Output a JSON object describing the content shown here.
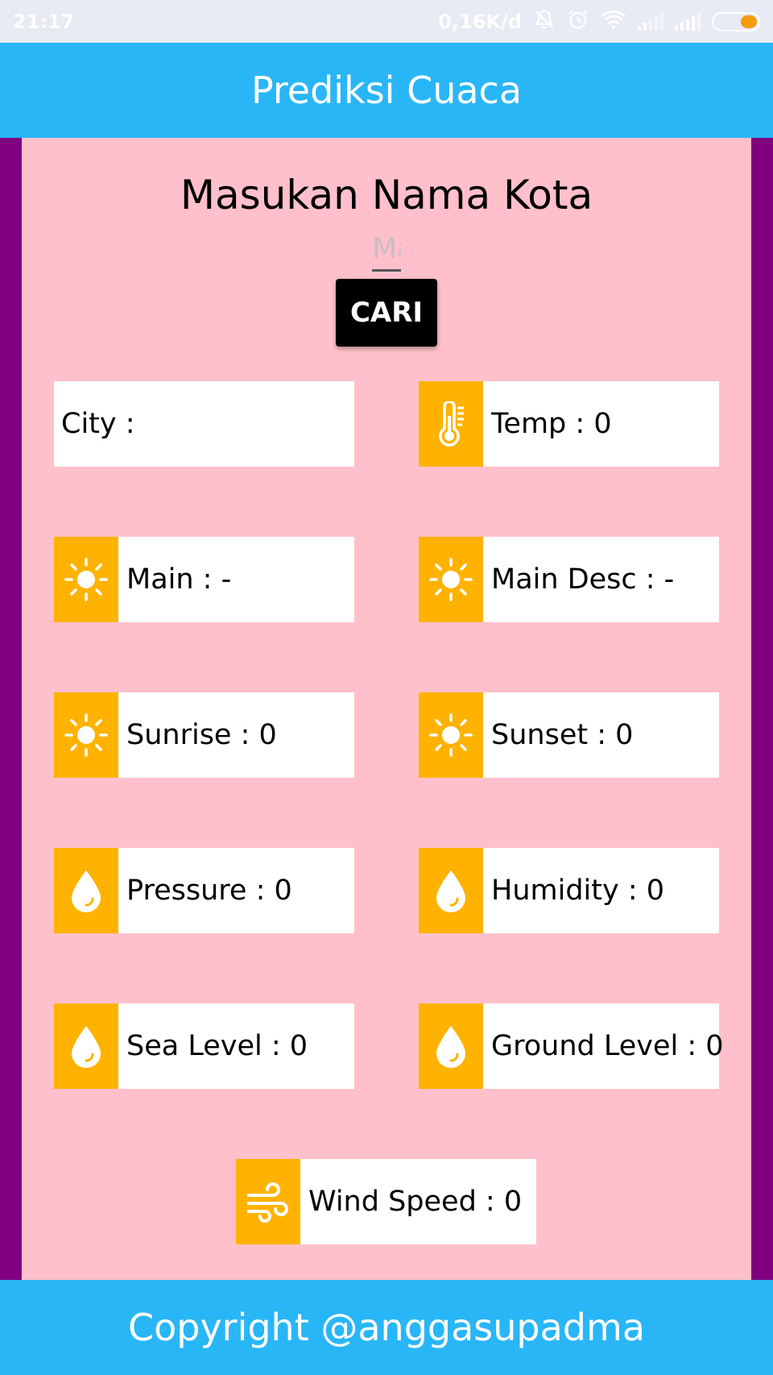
{
  "status_bar": {
    "time": "21:17",
    "network_speed": "0,16K/d",
    "icons": [
      "bell-off-icon",
      "alarm-icon",
      "wifi-icon",
      "signal-icon",
      "signal-icon",
      "battery-icon"
    ]
  },
  "app_bar": {
    "title": "Prediksi Cuaca"
  },
  "search": {
    "heading": "Masukan Nama Kota",
    "placeholder": "Ma",
    "button_label": "CARI"
  },
  "cards": {
    "city": {
      "label": "City :"
    },
    "temp": {
      "label": "Temp : 0",
      "icon": "thermometer-icon"
    },
    "main": {
      "label": "Main : -",
      "icon": "sun-icon"
    },
    "main_desc": {
      "label": "Main Desc : -",
      "icon": "sun-icon"
    },
    "sunrise": {
      "label": "Sunrise : 0",
      "icon": "sun-icon"
    },
    "sunset": {
      "label": "Sunset : 0",
      "icon": "sun-icon"
    },
    "pressure": {
      "label": "Pressure : 0",
      "icon": "water-drop-icon"
    },
    "humidity": {
      "label": "Humidity : 0",
      "icon": "water-drop-icon"
    },
    "sea_level": {
      "label": "Sea Level : 0",
      "icon": "water-drop-icon"
    },
    "ground_level": {
      "label": "Ground Level : 0",
      "icon": "water-drop-icon"
    },
    "wind_speed": {
      "label": "Wind Speed : 0",
      "icon": "wind-icon"
    }
  },
  "footer": {
    "text": "Copyright @anggasupadma"
  },
  "colors": {
    "app_bar": "#29b6f6",
    "content_bg": "#ffc0cb",
    "side_border": "#800080",
    "icon_bg": "#ffb300",
    "button_bg": "#000000"
  }
}
